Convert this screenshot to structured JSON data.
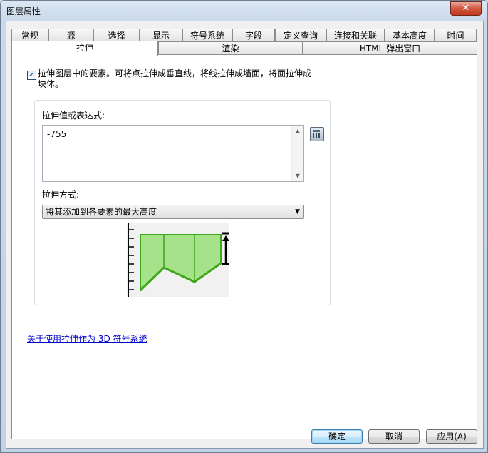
{
  "window": {
    "title": "图层属性",
    "close_label": "✕"
  },
  "tabs_row1": [
    "常规",
    "源",
    "选择",
    "显示",
    "符号系统",
    "字段",
    "定义查询",
    "连接和关联",
    "基本高度",
    "时间"
  ],
  "tabs_row2": [
    "拉伸",
    "渲染",
    "HTML 弹出窗口"
  ],
  "active_tab": "拉伸",
  "extrude": {
    "checkbox_checked": true,
    "checkbox_label": "拉伸图层中的要素。可将点拉伸成垂直线，将线拉伸成墙面，将面拉伸成块体。",
    "value_label": "拉伸值或表达式:",
    "value": "-755",
    "method_label": "拉伸方式:",
    "method_selected": "将其添加到各要素的最大高度"
  },
  "help_link": "关于使用拉伸作为 3D 符号系统",
  "buttons": {
    "ok": "确定",
    "cancel": "取消",
    "apply": "应用(A)"
  },
  "colors": {
    "diagram_fill": "#a6e28a",
    "diagram_line": "#3fa51a",
    "link": "#0000cc"
  },
  "icons": {
    "calculator": "calculator-icon",
    "dropdown": "chevron-down-icon"
  }
}
